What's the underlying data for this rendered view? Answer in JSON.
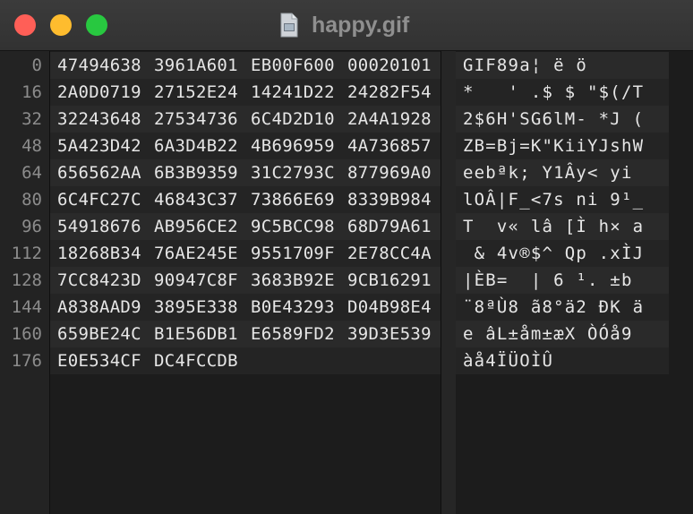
{
  "window": {
    "title": "happy.gif",
    "close_glyph": "✕",
    "minimize_glyph": "−",
    "zoom_glyph": "+"
  },
  "rows": [
    {
      "offset": "0",
      "hex": [
        "47494638",
        "3961A601",
        "EB00F600",
        "00020101"
      ],
      "ascii": "GIF89a¦ ë ö"
    },
    {
      "offset": "16",
      "hex": [
        "2A0D0719",
        "27152E24",
        "14241D22",
        "24282F54"
      ],
      "ascii": "*   ' .$ $ \"$(/T"
    },
    {
      "offset": "32",
      "hex": [
        "32243648",
        "27534736",
        "6C4D2D10",
        "2A4A1928"
      ],
      "ascii": "2$6H'SG6lM- *J ("
    },
    {
      "offset": "48",
      "hex": [
        "5A423D42",
        "6A3D4B22",
        "4B696959",
        "4A736857"
      ],
      "ascii": "ZB=Bj=K\"KiiYJshW"
    },
    {
      "offset": "64",
      "hex": [
        "656562AA",
        "6B3B9359",
        "31C2793C",
        "877969A0"
      ],
      "ascii": "eebªk; Y1Ây< yi"
    },
    {
      "offset": "80",
      "hex": [
        "6C4FC27C",
        "46843C37",
        "73866E69",
        "8339B984"
      ],
      "ascii": "lOÂ|F_<7s ni 9¹_"
    },
    {
      "offset": "96",
      "hex": [
        "54918676",
        "AB956CE2",
        "9C5BCC98",
        "68D79A61"
      ],
      "ascii": "T  v« lâ [Ì h× a"
    },
    {
      "offset": "112",
      "hex": [
        "18268B34",
        "76AE245E",
        "9551709F",
        "2E78CC4A"
      ],
      "ascii": " & 4v®$^ Qp .xÌJ"
    },
    {
      "offset": "128",
      "hex": [
        "7CC8423D",
        "90947C8F",
        "3683B92E",
        "9CB16291"
      ],
      "ascii": "|ÈB=  | 6 ¹. ±b"
    },
    {
      "offset": "144",
      "hex": [
        "A838AAD9",
        "3895E338",
        "B0E43293",
        "D04B98E4"
      ],
      "ascii": "¨8ªÙ8 ã8°ä2 ÐK ä"
    },
    {
      "offset": "160",
      "hex": [
        "659BE24C",
        "B1E56DB1",
        "E6589FD2",
        "39D3E539"
      ],
      "ascii": "e âL±åm±æX ÒÓå9"
    },
    {
      "offset": "176",
      "hex": [
        "E0E534CF",
        "DC4FCCDB"
      ],
      "ascii": "àå4ÏÜOÌÛ"
    }
  ],
  "colors": {
    "close": "#ff5f57",
    "minimize": "#febc2e",
    "zoom": "#28c840"
  },
  "icons": {
    "document": "document-icon"
  }
}
